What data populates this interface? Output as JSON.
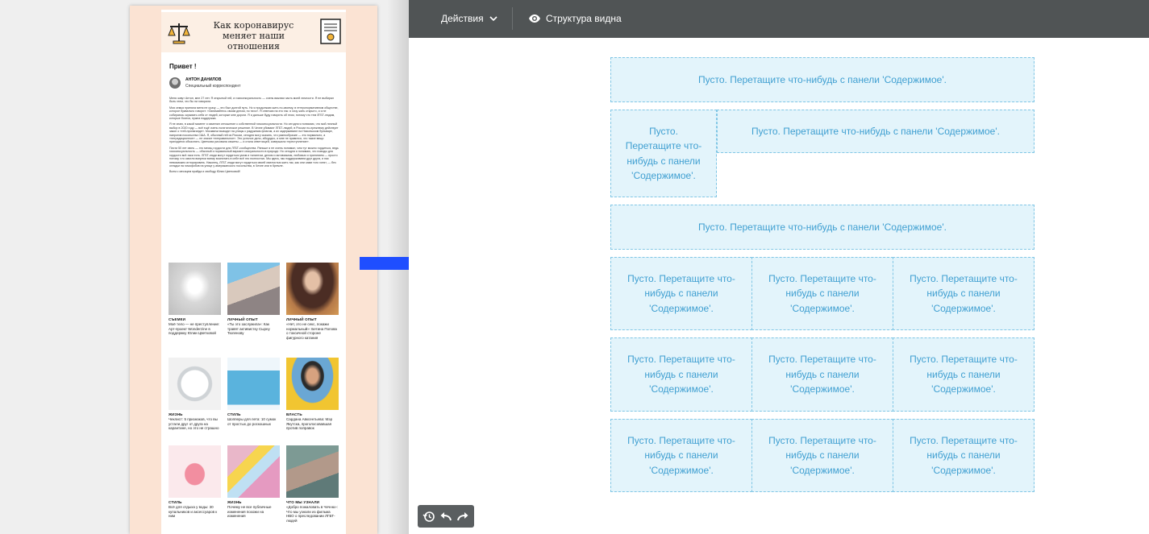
{
  "newsletter": {
    "title": "Как коронавирус меняет наши отношения",
    "greeting": "Привет !",
    "author_name": "АНТОН ДАНИЛОВ",
    "author_role": "Специальный корреспондент",
    "paragraphs": [
      "Меня зовут Антон, мне 27 лет. Я открытый гей, и гомосексуальность — очень важная часть моей личности. Я не выбирал быть геем, что бы ни говорили.",
      "Моя семья приняла меня не сразу — это был долгий путь. Но я продолжаю жить по-своему, в гетеронормативном обществе, которое буквально говорит: «Занимайтесь своим делом, но тихо». Я отвечаю на это так: я хочу жить открыто, и я не собираюсь скрывать себя от людей, которые мне дороги. Я и дальше буду говорить об этом, потому что тем ЛГБТ-людям, которые боятся, нужна поддержка.",
      "Я не знаю, в какой момент я изменил отношение к собственной гомосексуальности. Но сегодня я понимаю, что мой личный выбор в 2020 году — всё ещё очень политическое решение. В Чечне убивают ЛГБТ-людей, в России по-прежнему действует закон о «гей-пропаганде». Москвичи выходят на улицы с радужным флагом, а их задерживают на Никольском бульваре, напротив посольства США. Я, обычный гей из России, сегодня могу сказать, что разнообразие — это нормально, а «нетрадиционное» — не значит «неправильное». Это усталое дело, абсурдно, и мне не нравится, что такие вещи приходится объяснять. Цветкова рисовала сюжеты — и стала ответчицей, совершила «преступление».",
      "Почти 50 лет июнь — это месяц гордости для ЛГБТ-сообщества. Раньше я не очень понимал, чем тут можно гордиться, ведь гомосексуальность — обычный и нормальный вариант сексуальности в природе. Но сегодня я понимаю, что поводы для гордости всё-таки есть. ЛГБТ-люди могут гордиться умом и талантом, делом и активизмом, любовью и принятием — просто потому, что смогли вопреки всему воспитать в себе всё это полностью. Мы здесь, мы поддерживаем друг друга, и нас невозможно игнорировать. Наконец, ЛГБТ-люди могут гордиться своей смелостью жить так, как они сами того хотят, — без оглядки на гомофобов на улице у американского посольства, в Чечне или в Кремле.",
      "Всем с месяцем прайда и свободу Юлии Цветковой!"
    ],
    "cards": [
      {
        "category": "СЪЕМКИ",
        "title": "Моё тело — не преступление: Арт-проект Wonderzine в поддержку Юлии Цветковой"
      },
      {
        "category": "ЛИЧНЫЙ ОПЫТ",
        "title": "«Ты это заслужила»: Как травят активистку Сырну Тюленову"
      },
      {
        "category": "ЛИЧНЫЙ ОПЫТ",
        "title": "«Нет, это не секс, покажи нормальный»: Бетина Попова о токсичной стороне фигурного катания"
      },
      {
        "category": "ЖИЗНЬ",
        "title": "Чеклист: 5 признаков, что вы устали друг от друга на карантине, но это не страшно"
      },
      {
        "category": "СТИЛЬ",
        "title": "Шопперы для лета: 10 сумок от простых до роскошных"
      },
      {
        "category": "ВЛАСТЬ",
        "title": "Сардана Авксентьева: Мэр Якутска, проголосовавшая против поправок"
      },
      {
        "category": "СТИЛЬ",
        "title": "Всё для отдыха у воды: 30 купальников и аксессуаров к ним"
      },
      {
        "category": "ЖИЗНЬ",
        "title": "Почему не все публичные изменения похожи на изменения"
      },
      {
        "category": "ЧТО МЫ УЗНАЛИ",
        "title": "«Добро пожаловать в Чечню»: Что мы узнали из фильма НВО о преследовании ЛГБТ-людей"
      }
    ]
  },
  "toolbar": {
    "actions_label": "Действия",
    "structure_label": "Структура видна"
  },
  "slots": {
    "wide": "Пусто. Перетащите что-нибудь с панели 'Содержимое'.",
    "narrow": "Пусто. Перетащите что-нибудь с панели 'Содержимое'."
  },
  "icons": {
    "actions": "chevron-down-icon",
    "structure": "eye-icon",
    "history": "history-icon",
    "undo": "undo-icon",
    "redo": "redo-icon",
    "header_left": "scales-icon",
    "header_right": "certificate-icon"
  },
  "colors": {
    "toolbar_bg": "#505455",
    "slot_bg": "#e3f4fb",
    "slot_border": "#80c6e5",
    "slot_text": "#3f9fd1",
    "arrow": "#1f4eff",
    "preview_bg": "#fbe3d3"
  }
}
